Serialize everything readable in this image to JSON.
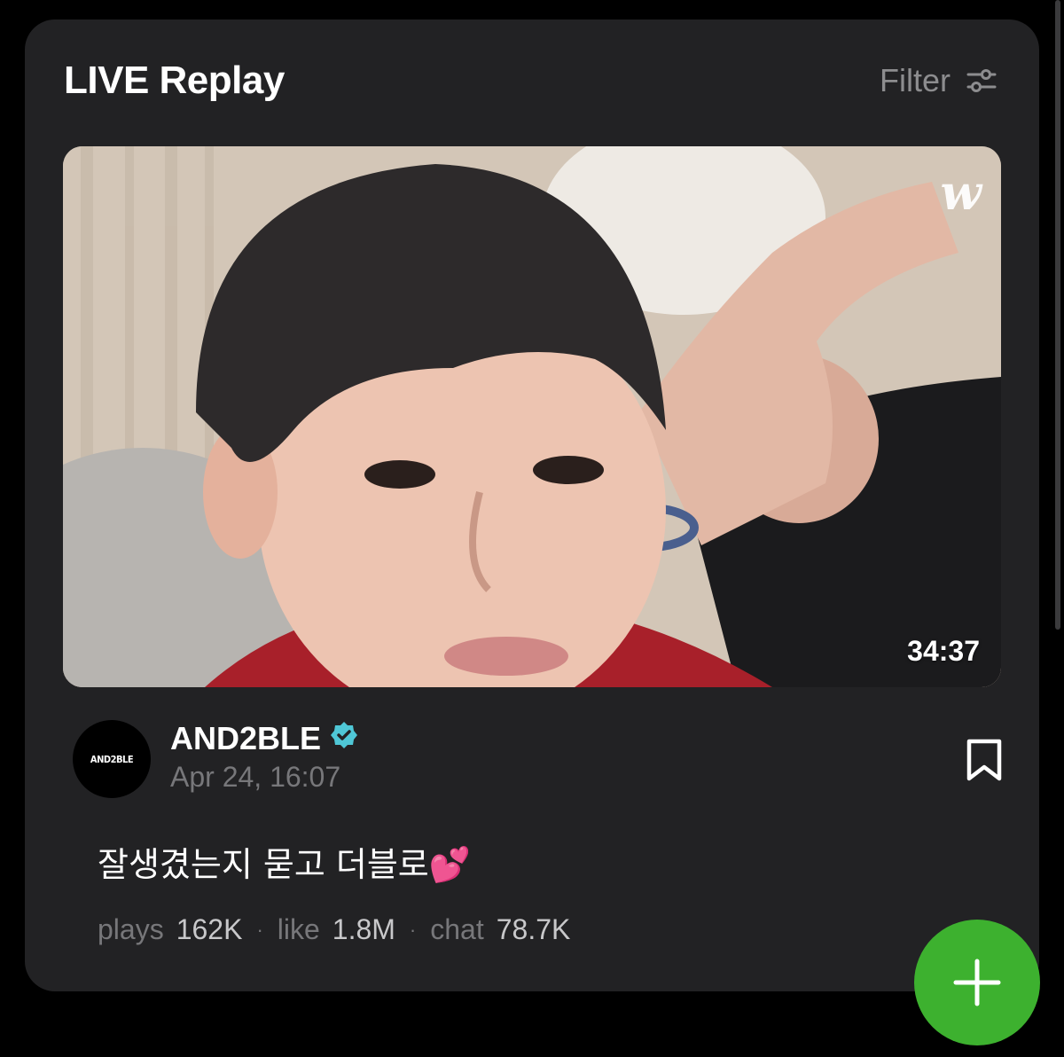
{
  "header": {
    "title": "LIVE Replay",
    "filter_label": "Filter",
    "filter_icon": "sliders-icon"
  },
  "video": {
    "watermark": "w",
    "duration": "34:37"
  },
  "channel": {
    "avatar_text": "AND2BLE",
    "name": "AND2BLE",
    "verified_icon": "verified-badge-icon",
    "verified_color": "#4fc7d6",
    "date": "Apr 24, 16:07",
    "bookmark_icon": "bookmark-icon"
  },
  "post": {
    "title": "잘생겼는지 묻고 더블로💕"
  },
  "stats": {
    "plays_label": "plays",
    "plays_value": "162K",
    "like_label": "like",
    "like_value": "1.8M",
    "chat_label": "chat",
    "chat_value": "78.7K",
    "separator": "·"
  },
  "fab": {
    "icon": "plus-icon",
    "color": "#3db12f"
  }
}
